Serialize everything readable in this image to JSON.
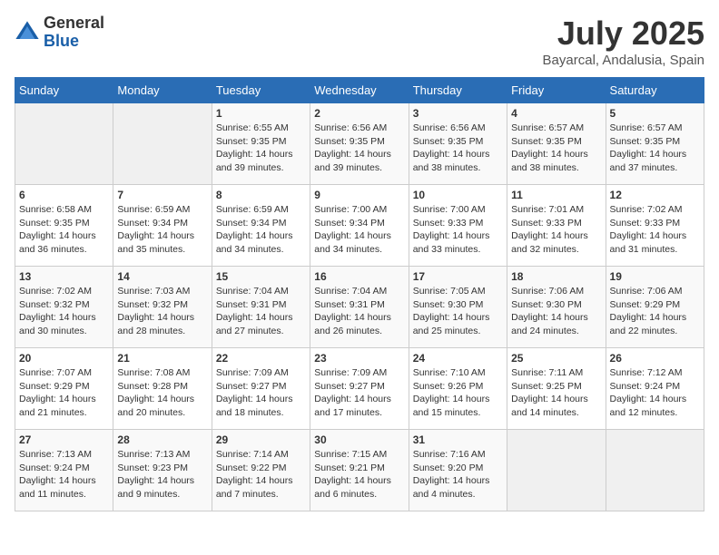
{
  "logo": {
    "general": "General",
    "blue": "Blue"
  },
  "title": "July 2025",
  "location": "Bayarcal, Andalusia, Spain",
  "days_of_week": [
    "Sunday",
    "Monday",
    "Tuesday",
    "Wednesday",
    "Thursday",
    "Friday",
    "Saturday"
  ],
  "weeks": [
    [
      {
        "day": "",
        "info": ""
      },
      {
        "day": "",
        "info": ""
      },
      {
        "day": "1",
        "info": "Sunrise: 6:55 AM\nSunset: 9:35 PM\nDaylight: 14 hours and 39 minutes."
      },
      {
        "day": "2",
        "info": "Sunrise: 6:56 AM\nSunset: 9:35 PM\nDaylight: 14 hours and 39 minutes."
      },
      {
        "day": "3",
        "info": "Sunrise: 6:56 AM\nSunset: 9:35 PM\nDaylight: 14 hours and 38 minutes."
      },
      {
        "day": "4",
        "info": "Sunrise: 6:57 AM\nSunset: 9:35 PM\nDaylight: 14 hours and 38 minutes."
      },
      {
        "day": "5",
        "info": "Sunrise: 6:57 AM\nSunset: 9:35 PM\nDaylight: 14 hours and 37 minutes."
      }
    ],
    [
      {
        "day": "6",
        "info": "Sunrise: 6:58 AM\nSunset: 9:35 PM\nDaylight: 14 hours and 36 minutes."
      },
      {
        "day": "7",
        "info": "Sunrise: 6:59 AM\nSunset: 9:34 PM\nDaylight: 14 hours and 35 minutes."
      },
      {
        "day": "8",
        "info": "Sunrise: 6:59 AM\nSunset: 9:34 PM\nDaylight: 14 hours and 34 minutes."
      },
      {
        "day": "9",
        "info": "Sunrise: 7:00 AM\nSunset: 9:34 PM\nDaylight: 14 hours and 34 minutes."
      },
      {
        "day": "10",
        "info": "Sunrise: 7:00 AM\nSunset: 9:33 PM\nDaylight: 14 hours and 33 minutes."
      },
      {
        "day": "11",
        "info": "Sunrise: 7:01 AM\nSunset: 9:33 PM\nDaylight: 14 hours and 32 minutes."
      },
      {
        "day": "12",
        "info": "Sunrise: 7:02 AM\nSunset: 9:33 PM\nDaylight: 14 hours and 31 minutes."
      }
    ],
    [
      {
        "day": "13",
        "info": "Sunrise: 7:02 AM\nSunset: 9:32 PM\nDaylight: 14 hours and 30 minutes."
      },
      {
        "day": "14",
        "info": "Sunrise: 7:03 AM\nSunset: 9:32 PM\nDaylight: 14 hours and 28 minutes."
      },
      {
        "day": "15",
        "info": "Sunrise: 7:04 AM\nSunset: 9:31 PM\nDaylight: 14 hours and 27 minutes."
      },
      {
        "day": "16",
        "info": "Sunrise: 7:04 AM\nSunset: 9:31 PM\nDaylight: 14 hours and 26 minutes."
      },
      {
        "day": "17",
        "info": "Sunrise: 7:05 AM\nSunset: 9:30 PM\nDaylight: 14 hours and 25 minutes."
      },
      {
        "day": "18",
        "info": "Sunrise: 7:06 AM\nSunset: 9:30 PM\nDaylight: 14 hours and 24 minutes."
      },
      {
        "day": "19",
        "info": "Sunrise: 7:06 AM\nSunset: 9:29 PM\nDaylight: 14 hours and 22 minutes."
      }
    ],
    [
      {
        "day": "20",
        "info": "Sunrise: 7:07 AM\nSunset: 9:29 PM\nDaylight: 14 hours and 21 minutes."
      },
      {
        "day": "21",
        "info": "Sunrise: 7:08 AM\nSunset: 9:28 PM\nDaylight: 14 hours and 20 minutes."
      },
      {
        "day": "22",
        "info": "Sunrise: 7:09 AM\nSunset: 9:27 PM\nDaylight: 14 hours and 18 minutes."
      },
      {
        "day": "23",
        "info": "Sunrise: 7:09 AM\nSunset: 9:27 PM\nDaylight: 14 hours and 17 minutes."
      },
      {
        "day": "24",
        "info": "Sunrise: 7:10 AM\nSunset: 9:26 PM\nDaylight: 14 hours and 15 minutes."
      },
      {
        "day": "25",
        "info": "Sunrise: 7:11 AM\nSunset: 9:25 PM\nDaylight: 14 hours and 14 minutes."
      },
      {
        "day": "26",
        "info": "Sunrise: 7:12 AM\nSunset: 9:24 PM\nDaylight: 14 hours and 12 minutes."
      }
    ],
    [
      {
        "day": "27",
        "info": "Sunrise: 7:13 AM\nSunset: 9:24 PM\nDaylight: 14 hours and 11 minutes."
      },
      {
        "day": "28",
        "info": "Sunrise: 7:13 AM\nSunset: 9:23 PM\nDaylight: 14 hours and 9 minutes."
      },
      {
        "day": "29",
        "info": "Sunrise: 7:14 AM\nSunset: 9:22 PM\nDaylight: 14 hours and 7 minutes."
      },
      {
        "day": "30",
        "info": "Sunrise: 7:15 AM\nSunset: 9:21 PM\nDaylight: 14 hours and 6 minutes."
      },
      {
        "day": "31",
        "info": "Sunrise: 7:16 AM\nSunset: 9:20 PM\nDaylight: 14 hours and 4 minutes."
      },
      {
        "day": "",
        "info": ""
      },
      {
        "day": "",
        "info": ""
      }
    ]
  ]
}
